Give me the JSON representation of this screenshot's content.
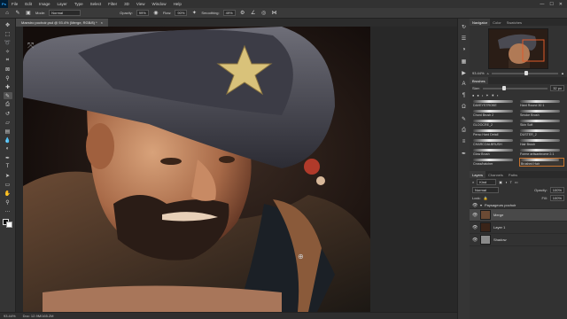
{
  "app": {
    "logo": "Ps"
  },
  "menu": [
    "File",
    "Edit",
    "Image",
    "Layer",
    "Type",
    "Select",
    "Filter",
    "3D",
    "View",
    "Window",
    "Help"
  ],
  "window_controls": [
    "—",
    "☐",
    "✕"
  ],
  "options_bar": {
    "mode_label": "Mode:",
    "mode_value": "Normal",
    "opacity_label": "Opacity:",
    "opacity_value": "99%",
    "flow_label": "Flow:",
    "flow_value": "90%",
    "smoothing_label": "Smoothing:",
    "smoothing_value": "49%"
  },
  "document_tab": {
    "title": "Maestro pochoir.psd @ 93.4% (Merge, RGB/8) *",
    "close": "×"
  },
  "status_bar": {
    "zoom": "93.44%",
    "doc": "Doc: 12.9M/165.2M"
  },
  "navigator": {
    "tabs": [
      "Navigator",
      "Color",
      "Swatches"
    ],
    "zoom": "93.44%",
    "zoom_fraction": 0.5
  },
  "brushes": {
    "tabs": [
      "Brushes"
    ],
    "size_label": "Size:",
    "size_value": "32 px",
    "items": [
      {
        "name": "DAVEYSTROKE",
        "selected": false
      },
      {
        "name": "Hard Round 30 1",
        "selected": false
      },
      {
        "name": "Chord Brush 2",
        "selected": false
      },
      {
        "name": "Smoke Brush",
        "selected": false
      },
      {
        "name": "GLOOCRE_2",
        "selected": false
      },
      {
        "name": "Skin Soft",
        "selected": false
      },
      {
        "name": "Perso Hard Detail",
        "selected": false
      },
      {
        "name": "DUSTER_2",
        "selected": false
      },
      {
        "name": "CHARCOALBRUSH",
        "selected": false
      },
      {
        "name": "Hair Brush",
        "selected": false
      },
      {
        "name": "Glow Brush",
        "selected": false
      },
      {
        "name": "Forme artisanbrome 2.1",
        "selected": false
      },
      {
        "name": "Cross/hatcher",
        "selected": false
      },
      {
        "name": "Brushed Hair",
        "selected": true
      }
    ]
  },
  "layers": {
    "tabs": [
      "Layers",
      "Channels",
      "Paths"
    ],
    "kind_label": "Kind",
    "blend_mode": "Normal",
    "opacity_label": "Opacity:",
    "opacity_value": "100%",
    "lock_label": "Lock:",
    "fill_label": "Fill:",
    "fill_value": "100%",
    "group_name": "Paysageurs pochoir",
    "items": [
      {
        "name": "Merge",
        "selected": true,
        "thumb_color": "#6b4a34"
      },
      {
        "name": "Layer 1",
        "selected": false,
        "thumb_color": "#3a2418"
      },
      {
        "name": "Shadow",
        "selected": false,
        "thumb_color": "#8a8a8a"
      }
    ]
  },
  "colors": {
    "accent": "#c8742f",
    "ps_blue": "#31a8ff"
  }
}
